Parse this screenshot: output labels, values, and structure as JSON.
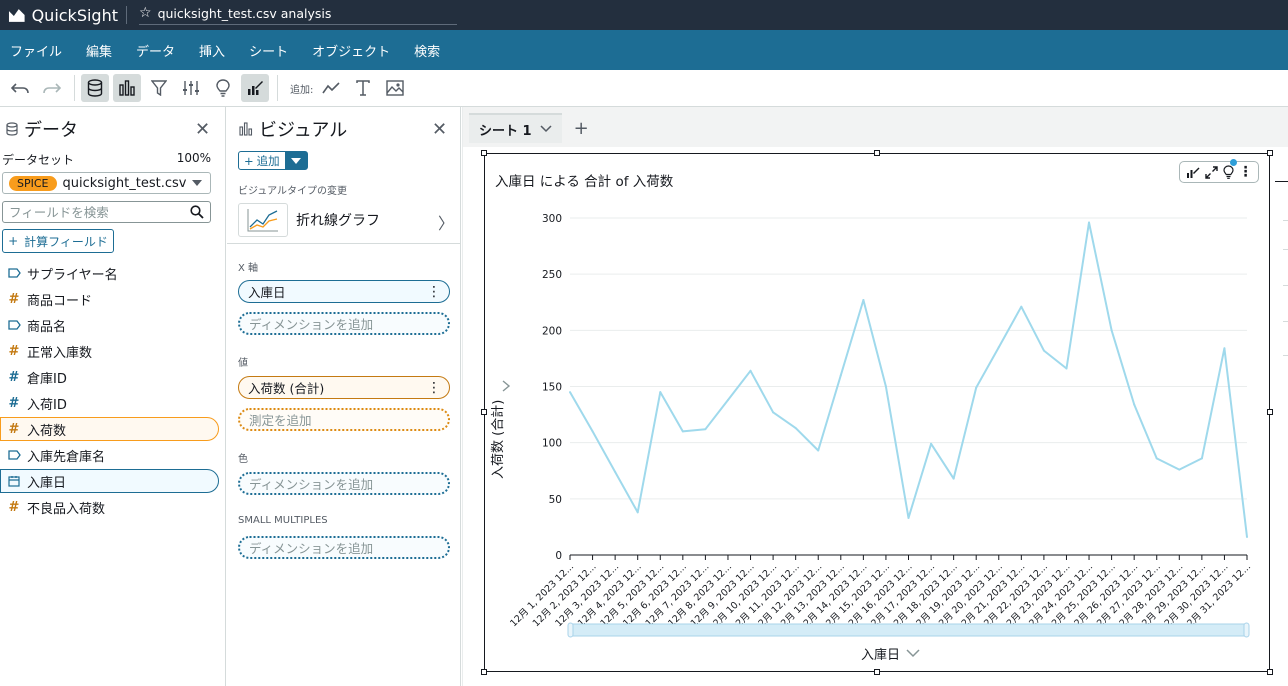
{
  "app": {
    "name": "QuickSight",
    "analysis_title": "quicksight_test.csv analysis"
  },
  "menu": [
    "ファイル",
    "編集",
    "データ",
    "挿入",
    "シート",
    "オブジェクト",
    "検索"
  ],
  "toolbar": {
    "add_label": "追加:"
  },
  "data_panel": {
    "title": "データ",
    "dataset_label": "データセット",
    "dataset_percent": "100%",
    "spice_badge": "SPICE",
    "dataset_name": "quicksight_test.csv",
    "search_placeholder": "フィールドを検索",
    "calc_field_label": "計算フィールド",
    "fields": [
      {
        "name": "サプライヤー名",
        "type": "dimension"
      },
      {
        "name": "商品コード",
        "type": "measure"
      },
      {
        "name": "商品名",
        "type": "dimension"
      },
      {
        "name": "正常入庫数",
        "type": "measure"
      },
      {
        "name": "倉庫ID",
        "type": "measure-blue"
      },
      {
        "name": "入荷ID",
        "type": "measure-blue"
      },
      {
        "name": "入荷数",
        "type": "measure",
        "selected": true
      },
      {
        "name": "入庫先倉庫名",
        "type": "dimension"
      },
      {
        "name": "入庫日",
        "type": "date",
        "selected": true
      },
      {
        "name": "不良品入荷数",
        "type": "measure"
      }
    ]
  },
  "visual_panel": {
    "title": "ビジュアル",
    "add_label": "追加",
    "change_type_label": "ビジュアルタイプの変更",
    "visual_type_name": "折れ線グラフ",
    "x_axis_label": "X 軸",
    "x_axis_field": "入庫日",
    "x_axis_placeholder": "ディメンションを追加",
    "value_label": "値",
    "value_field": "入荷数 (合計)",
    "value_placeholder": "測定を追加",
    "color_label": "色",
    "color_placeholder": "ディメンションを追加",
    "small_multiples_label": "SMALL MULTIPLES",
    "small_multiples_placeholder": "ディメンションを追加"
  },
  "sheet": {
    "tab_name": "シート 1"
  },
  "colors": {
    "line": "#9fd9ec",
    "accent": "#1d6d94",
    "measure": "#f89c1c",
    "menubar": "#1d6d94",
    "titlebar": "#232f3e"
  },
  "chart_data": {
    "type": "line",
    "title": "入庫日 による 合計 of 入荷数",
    "xlabel": "入庫日",
    "ylabel": "入荷数 (合計)",
    "ylim": [
      0,
      300
    ],
    "yticks": [
      0,
      50,
      100,
      150,
      200,
      250,
      300
    ],
    "grid": true,
    "categories": [
      "12月 1, 2023 12...",
      "12月 2, 2023 12...",
      "12月 3, 2023 12...",
      "12月 4, 2023 12...",
      "12月 5, 2023 12...",
      "12月 6, 2023 12...",
      "12月 7, 2023 12...",
      "12月 8, 2023 12...",
      "12月 9, 2023 12...",
      "12月 10, 2023 12...",
      "12月 11, 2023 12...",
      "12月 12, 2023 12...",
      "12月 13, 2023 12...",
      "12月 14, 2023 12...",
      "12月 15, 2023 12...",
      "12月 16, 2023 12...",
      "12月 17, 2023 12...",
      "12月 18, 2023 12...",
      "12月 19, 2023 12...",
      "12月 20, 2023 12...",
      "12月 21, 2023 12...",
      "12月 22, 2023 12...",
      "12月 23, 2023 12...",
      "12月 24, 2023 12...",
      "12月 25, 2023 12...",
      "12月 26, 2023 12...",
      "12月 27, 2023 12...",
      "12月 28, 2023 12...",
      "12月 29, 2023 12...",
      "12月 30, 2023 12...",
      "12月 31, 2023 12..."
    ],
    "values": [
      145,
      110,
      74,
      38,
      145,
      110,
      112,
      138,
      164,
      127,
      113,
      93,
      160,
      227,
      150,
      33,
      99,
      68,
      149,
      185,
      221,
      182,
      166,
      296,
      200,
      134,
      86,
      76,
      86,
      184,
      16
    ]
  }
}
